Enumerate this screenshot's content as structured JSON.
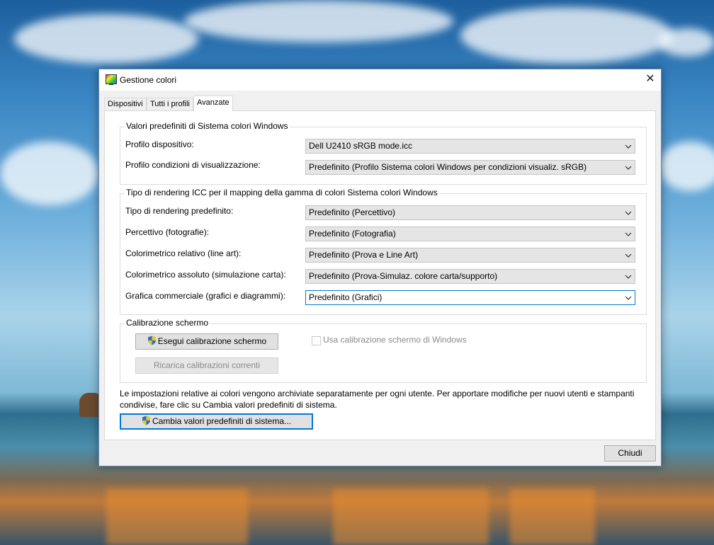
{
  "window": {
    "title": "Gestione colori",
    "close_glyph": "✕",
    "icon": "color-management-monitor-icon"
  },
  "tabs": [
    {
      "label": "Dispositivi",
      "active": false
    },
    {
      "label": "Tutti i profili",
      "active": false
    },
    {
      "label": "Avanzate",
      "active": true
    }
  ],
  "defaults_group": {
    "title": "Valori predefiniti di Sistema colori Windows",
    "rows": [
      {
        "label": "Profilo dispositivo:",
        "value": "Dell U2410 sRGB mode.icc"
      },
      {
        "label": "Profilo condizioni di visualizzazione:",
        "value": "Predefinito (Profilo Sistema colori Windows per condizioni visualiz. sRGB)"
      }
    ]
  },
  "rendering_group": {
    "title": "Tipo di rendering ICC per il mapping della gamma di colori Sistema colori Windows",
    "rows": [
      {
        "label": "Tipo di rendering predefinito:",
        "value": "Predefinito (Percettivo)"
      },
      {
        "label": "Percettivo (fotografie):",
        "value": "Predefinito (Fotografia)"
      },
      {
        "label": "Colorimetrico relativo (line art):",
        "value": "Predefinito (Prova e Line Art)"
      },
      {
        "label": "Colorimetrico assoluto (simulazione carta):",
        "value": "Predefinito (Prova-Simulaz. colore carta/supporto)"
      },
      {
        "label": "Grafica commerciale (grafici e diagrammi):",
        "value": "Predefinito (Grafici)"
      }
    ]
  },
  "calibration_group": {
    "title": "Calibrazione schermo",
    "run_button": "Esegui calibrazione schermo",
    "reload_button": "Ricarica calibrazioni correnti",
    "checkbox_label": "Usa calibrazione schermo di Windows",
    "checkbox_checked": false
  },
  "info_text": "Le impostazioni relative ai colori vengono archiviate separatamente per ogni utente. Per apportare modifiche per nuovi utenti e stampanti condivise, fare clic su Cambia valori predefiniti di sistema.",
  "change_defaults_button": "Cambia valori predefiniti di sistema...",
  "close_button": "Chiudi",
  "colors": {
    "accent": "#0078d7",
    "window_bg": "#f0f0f0",
    "panel_bg": "#ffffff"
  }
}
